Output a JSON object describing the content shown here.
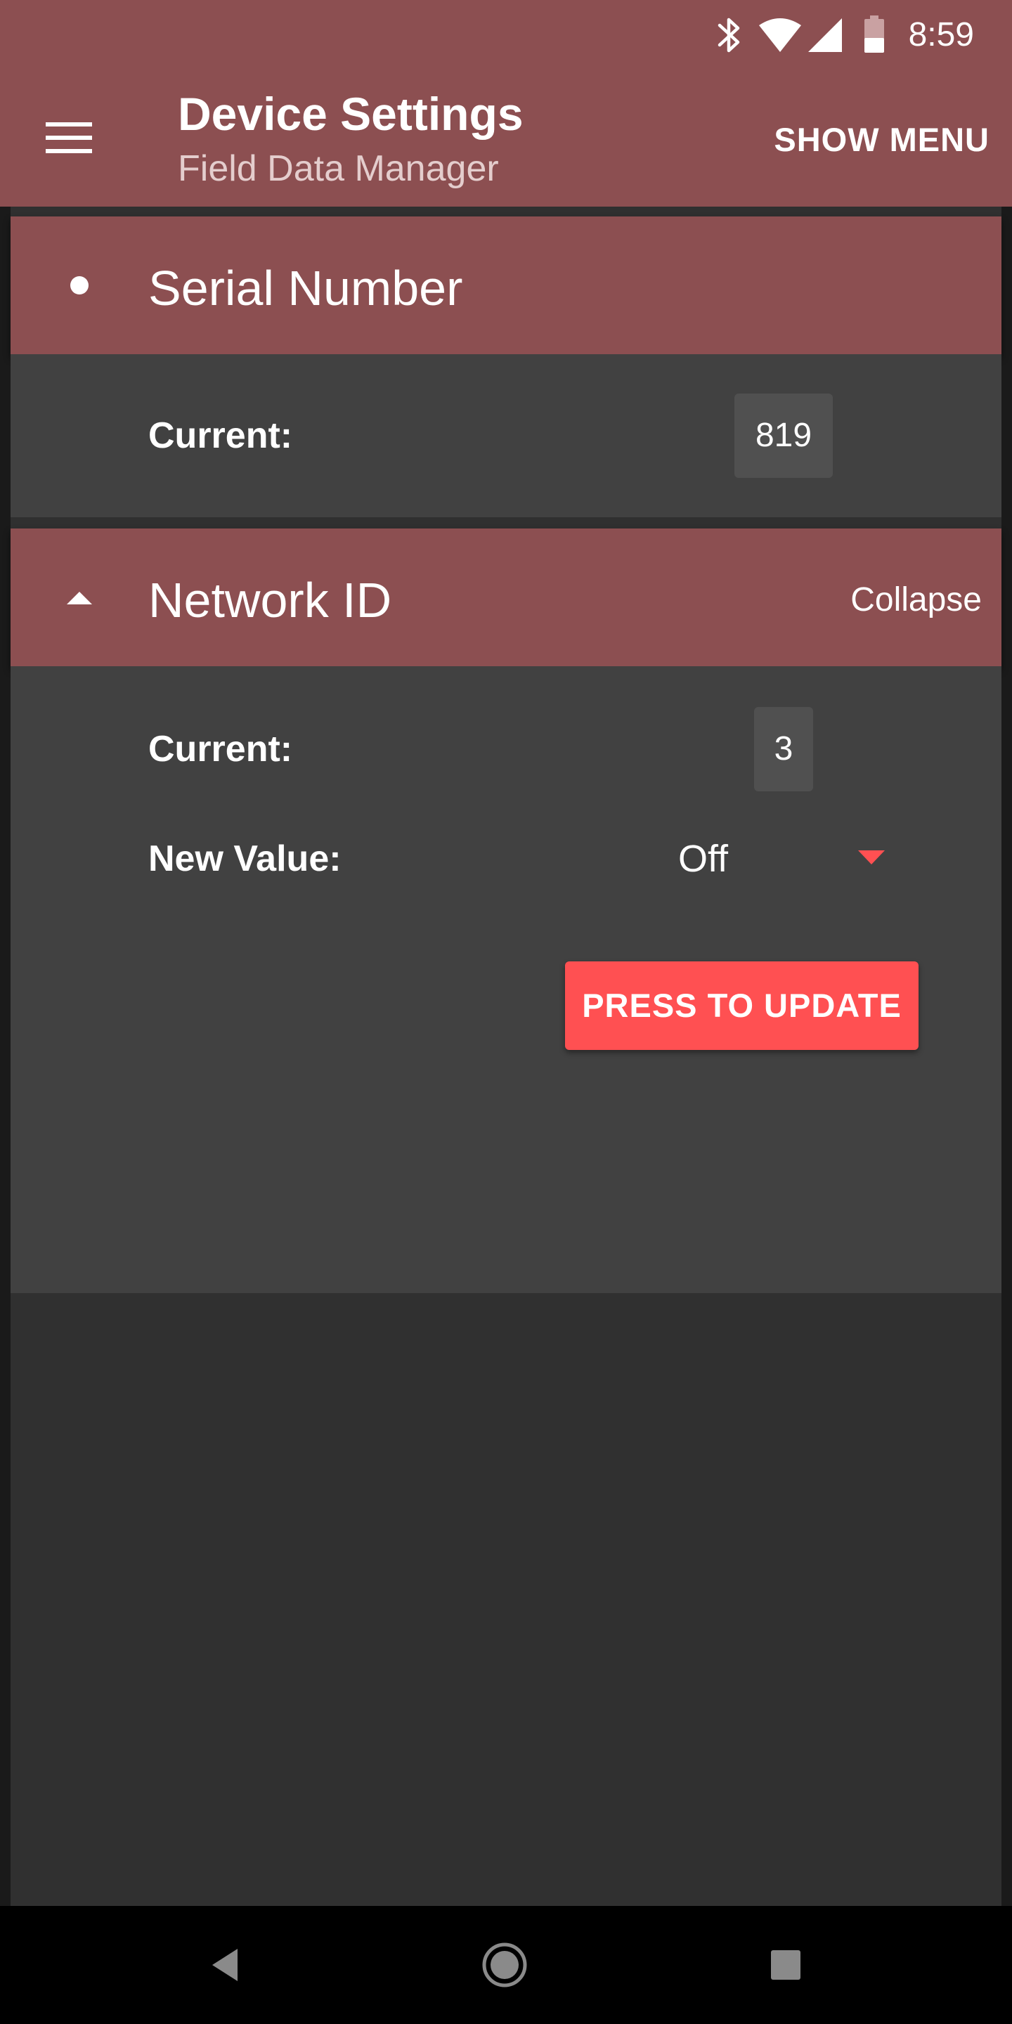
{
  "status_bar": {
    "time": "8:59",
    "icons": [
      "bluetooth-icon",
      "wifi-icon",
      "cell-signal-icon",
      "battery-icon"
    ]
  },
  "app_bar": {
    "title": "Device Settings",
    "subtitle": "Field Data Manager",
    "menu_icon": "hamburger-menu-icon",
    "action_label": "SHOW MENU"
  },
  "sections": {
    "serial": {
      "title": "Serial Number",
      "lead_icon": "bullet-dot-icon",
      "current_label": "Current:",
      "current_value": "819"
    },
    "network": {
      "title": "Network ID",
      "lead_icon": "collapse-arrow-up-icon",
      "collapse_label": "Collapse",
      "current_label": "Current:",
      "current_value": "3",
      "new_value_label": "New Value:",
      "new_value_selected": "Off",
      "update_button": "PRESS TO UPDATE"
    }
  },
  "nav_bar": {
    "icons": [
      "back-icon",
      "home-icon",
      "recents-icon"
    ]
  },
  "colors": {
    "header": "#8c4f51",
    "content_background": "#303030",
    "section_body": "#414141",
    "accent": "#ff5052",
    "nav_bar": "#000000"
  }
}
